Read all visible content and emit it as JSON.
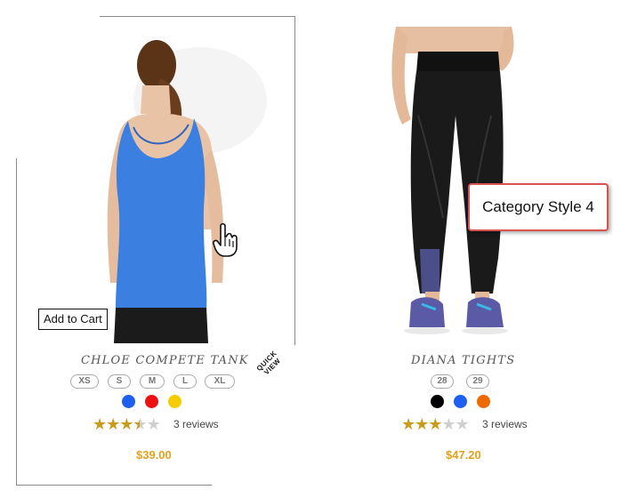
{
  "products": [
    {
      "name": "CHLOE COMPETE TANK",
      "add_to_cart": "Add to Cart",
      "quick_view": "QUICK VIEW",
      "sizes": [
        "XS",
        "S",
        "M",
        "L",
        "XL"
      ],
      "colors": [
        "#1e5ff0",
        "#ee1111",
        "#f5cc00"
      ],
      "rating": 3.5,
      "reviews": "3 reviews",
      "price": "$39.00"
    },
    {
      "name": "DIANA TIGHTS",
      "sizes": [
        "28",
        "29"
      ],
      "colors": [
        "#000000",
        "#1e5ff0",
        "#ee6a00"
      ],
      "rating": 3.0,
      "reviews": "3 reviews",
      "price": "$47.20"
    }
  ],
  "callout": {
    "label": "Category Style 4"
  },
  "theme": {
    "accent_price": "#e0a11b",
    "callout_border": "#d9534f",
    "star": "#c99b1a"
  }
}
